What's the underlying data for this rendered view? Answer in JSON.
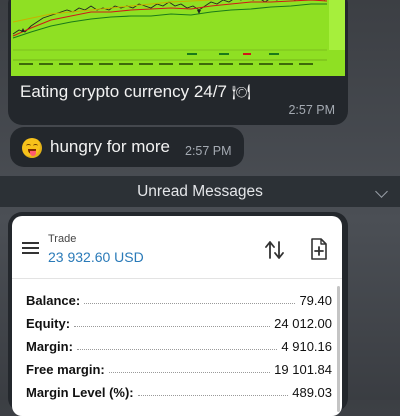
{
  "messages": [
    {
      "text": "Eating crypto currency 24/7",
      "icon": "plate-cutlery-icon",
      "time": "2:57 PM"
    },
    {
      "text": "hungry for more",
      "emoji": "yum-face-emoji",
      "time": "2:57 PM"
    }
  ],
  "unread": {
    "label": "Unread Messages"
  },
  "trade_card": {
    "title": "Trade",
    "balance_header": "23 932.60 USD",
    "rows": [
      {
        "label": "Balance:",
        "value": "79.40"
      },
      {
        "label": "Equity:",
        "value": "24 012.00"
      },
      {
        "label": "Margin:",
        "value": "4 910.16"
      },
      {
        "label": "Free margin:",
        "value": "19 101.84"
      },
      {
        "label": "Margin Level (%):",
        "value": "489.03"
      }
    ]
  },
  "colors": {
    "chart_background": "#8fe023",
    "bubble": "#23272c",
    "accent_blue": "#2a7ab8"
  }
}
